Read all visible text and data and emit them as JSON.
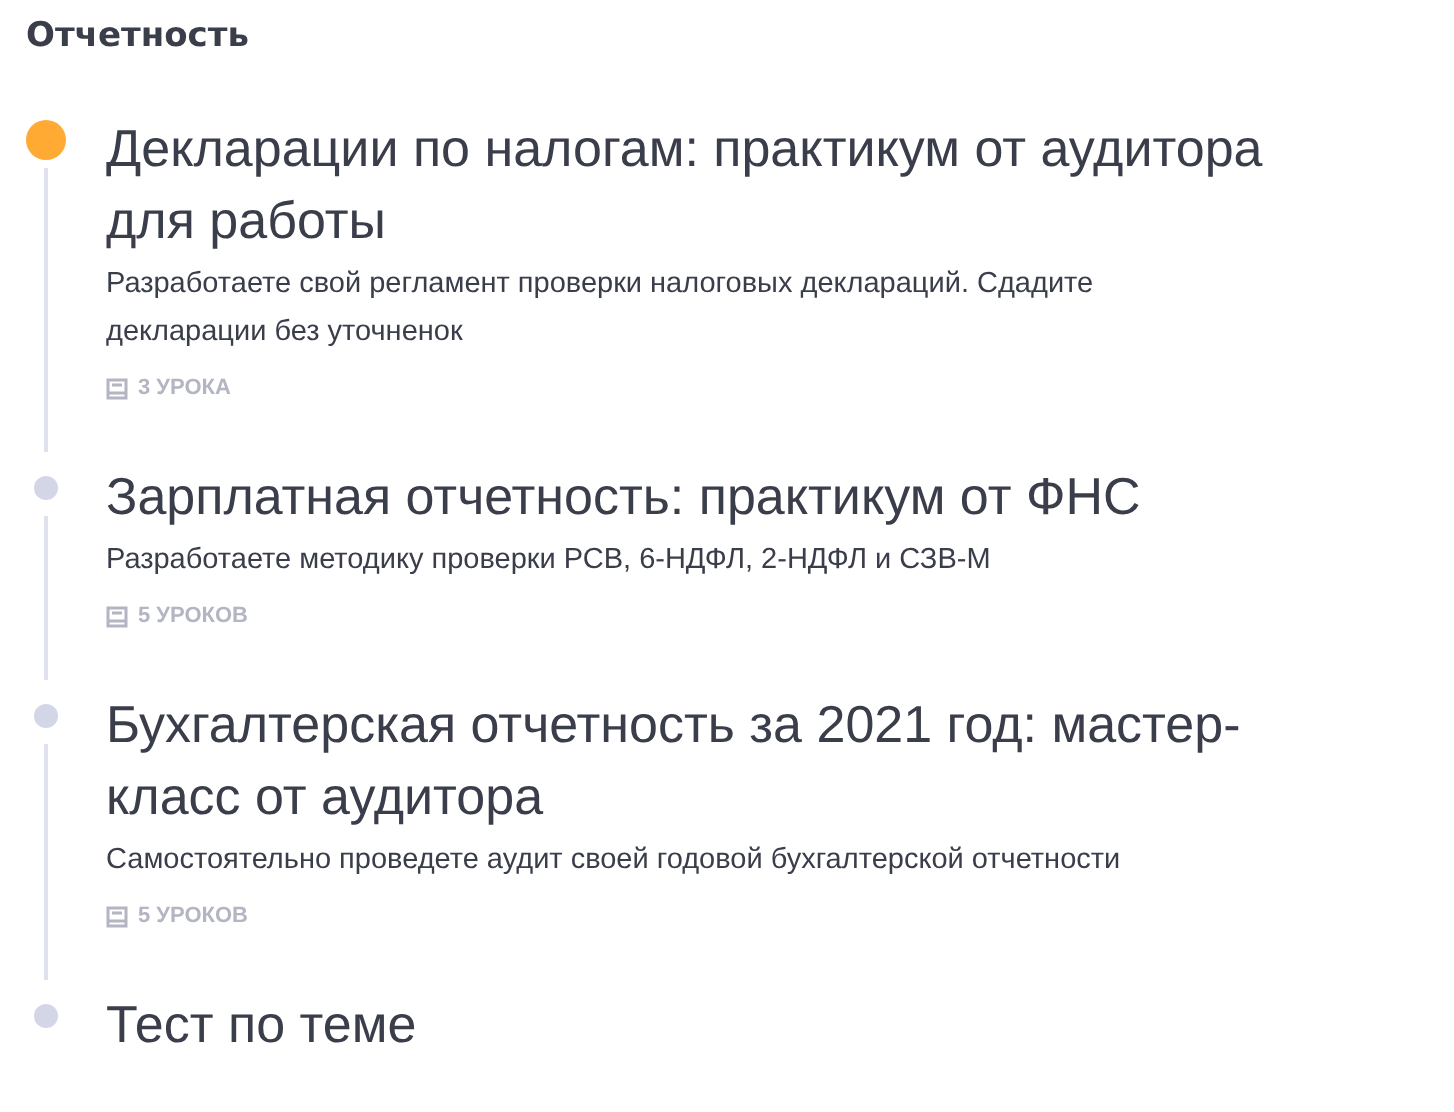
{
  "section_title": "Отчетность",
  "items": [
    {
      "title": "Декларации по налогам: практикум от аудитора для работы",
      "description": "Разработаете свой регламент проверки налоговых деклараций. Сдадите декларации без уточненок",
      "lessons": "3 УРОКА",
      "active": true
    },
    {
      "title": "Зарплатная отчетность: практикум от ФНС",
      "description": "Разработаете методику проверки РСВ, 6-НДФЛ, 2-НДФЛ и СЗВ-М",
      "lessons": "5 УРОКОВ",
      "active": false
    },
    {
      "title": "Бухгалтерская отчетность за 2021 год: мастер-класс от аудитора",
      "description": "Самостоятельно проведете аудит своей годовой бухгалтерской отчетности",
      "lessons": "5 УРОКОВ",
      "active": false
    },
    {
      "title": "Тест по теме",
      "active": false
    }
  ]
}
